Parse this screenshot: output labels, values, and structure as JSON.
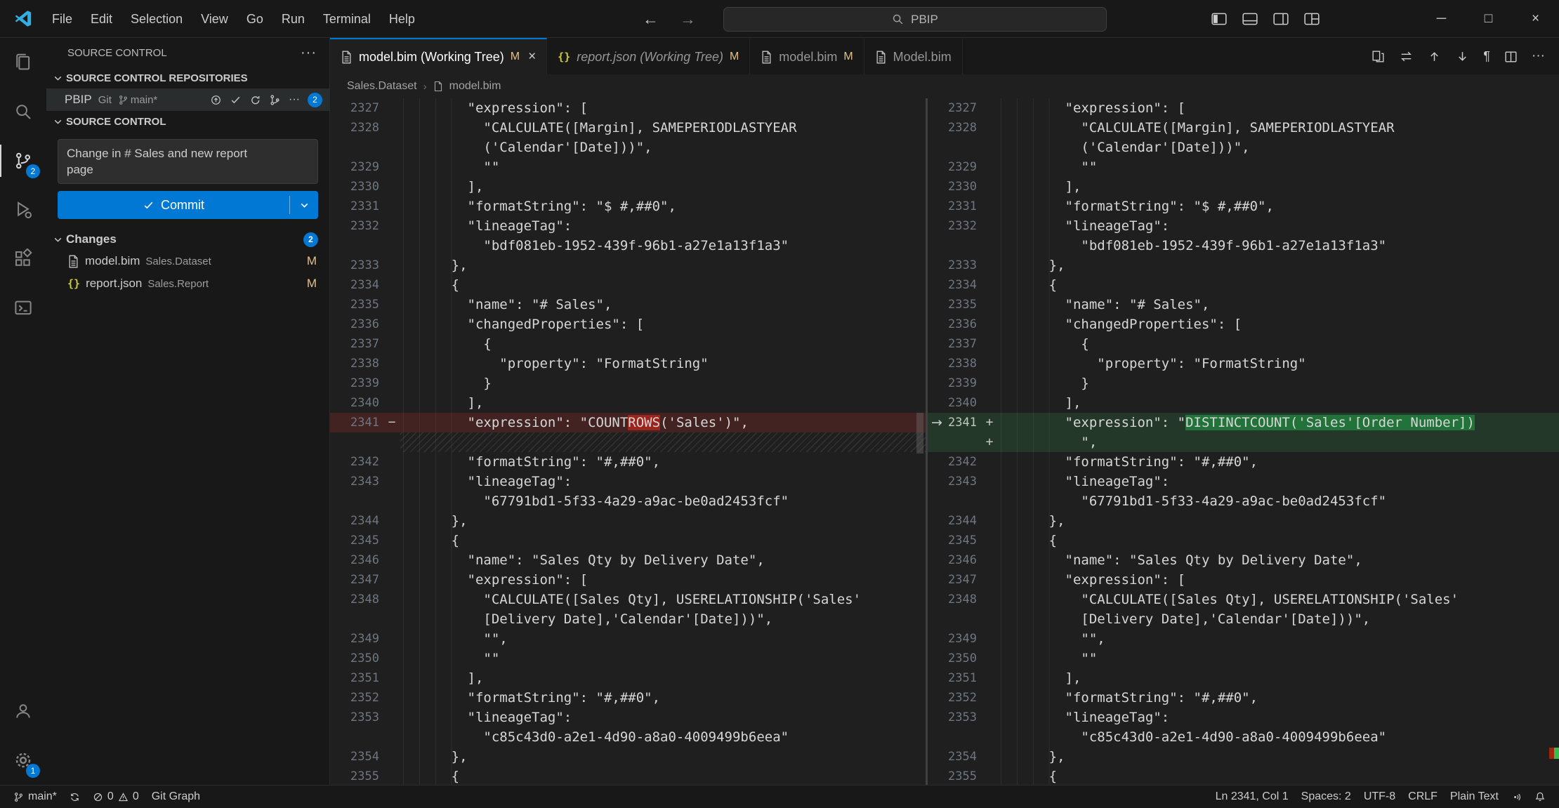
{
  "titlebar": {
    "menus": [
      "File",
      "Edit",
      "Selection",
      "View",
      "Go",
      "Run",
      "Terminal",
      "Help"
    ],
    "command_center": "PBIP"
  },
  "activity_bar": {
    "scm_badge": "2",
    "gear_badge": "1"
  },
  "sidebar": {
    "panel_title": "SOURCE CONTROL",
    "repos_section": "SOURCE CONTROL REPOSITORIES",
    "repo": {
      "name": "PBIP",
      "vcs": "Git",
      "branch": "main*",
      "badge": "2"
    },
    "scm_section": "SOURCE CONTROL",
    "commit_message": "Change in # Sales and new report\npage",
    "commit_label": "Commit",
    "changes_label": "Changes",
    "changes_badge": "2",
    "changes": [
      {
        "file": "model.bim",
        "project": "Sales.Dataset",
        "status": "M",
        "icon": "file"
      },
      {
        "file": "report.json",
        "project": "Sales.Report",
        "status": "M",
        "icon": "json"
      }
    ]
  },
  "tabs": [
    {
      "label": "model.bim (Working Tree)",
      "modified": "M",
      "active": true,
      "italic": false,
      "icon": "file"
    },
    {
      "label": "report.json (Working Tree)",
      "modified": "M",
      "active": false,
      "italic": true,
      "icon": "json"
    },
    {
      "label": "model.bim",
      "modified": "M",
      "active": false,
      "italic": false,
      "icon": "file"
    },
    {
      "label": "Model.bim",
      "modified": "",
      "active": false,
      "italic": false,
      "icon": "file"
    }
  ],
  "breadcrumb": [
    "Sales.Dataset",
    "model.bim"
  ],
  "editor": {
    "left_rows": [
      {
        "n": "2327",
        "t": "        \"expression\": ["
      },
      {
        "n": "2328",
        "t": "          \"CALCULATE([Margin], SAMEPERIODLASTYEAR"
      },
      {
        "n": "",
        "t": "          ('Calendar'[Date]))\","
      },
      {
        "n": "2329",
        "t": "          \"\""
      },
      {
        "n": "2330",
        "t": "        ],"
      },
      {
        "n": "2331",
        "t": "        \"formatString\": \"$ #,##0\","
      },
      {
        "n": "2332",
        "t": "        \"lineageTag\":"
      },
      {
        "n": "",
        "t": "          \"bdf081eb-1952-439f-96b1-a27e1a13f1a3\""
      },
      {
        "n": "2333",
        "t": "      },"
      },
      {
        "n": "2334",
        "t": "      {"
      },
      {
        "n": "2335",
        "t": "        \"name\": \"# Sales\","
      },
      {
        "n": "2336",
        "t": "        \"changedProperties\": ["
      },
      {
        "n": "2337",
        "t": "          {"
      },
      {
        "n": "2338",
        "t": "            \"property\": \"FormatString\""
      },
      {
        "n": "2339",
        "t": "          }"
      },
      {
        "n": "2340",
        "t": "        ],"
      },
      {
        "n": "2341",
        "mark": "−",
        "cls": "removed",
        "hl": [
          "        \"expression\": \"COUNT",
          "ROWS",
          "('Sales')\","
        ]
      },
      {
        "n": "",
        "cls": "hatch",
        "t": ""
      },
      {
        "n": "2342",
        "t": "        \"formatString\": \"#,##0\","
      },
      {
        "n": "2343",
        "t": "        \"lineageTag\":"
      },
      {
        "n": "",
        "t": "          \"67791bd1-5f33-4a29-a9ac-be0ad2453fcf\""
      },
      {
        "n": "2344",
        "t": "      },"
      },
      {
        "n": "2345",
        "t": "      {"
      },
      {
        "n": "2346",
        "t": "        \"name\": \"Sales Qty by Delivery Date\","
      },
      {
        "n": "2347",
        "t": "        \"expression\": ["
      },
      {
        "n": "2348",
        "t": "          \"CALCULATE([Sales Qty], USERELATIONSHIP('Sales'"
      },
      {
        "n": "",
        "t": "          [Delivery Date],'Calendar'[Date]))\","
      },
      {
        "n": "2349",
        "t": "          \"\","
      },
      {
        "n": "2350",
        "t": "          \"\""
      },
      {
        "n": "2351",
        "t": "        ],"
      },
      {
        "n": "2352",
        "t": "        \"formatString\": \"#,##0\","
      },
      {
        "n": "2353",
        "t": "        \"lineageTag\":"
      },
      {
        "n": "",
        "t": "          \"c85c43d0-a2e1-4d90-a8a0-4009499b6eea\""
      },
      {
        "n": "2354",
        "t": "      },"
      },
      {
        "n": "2355",
        "t": "      {"
      }
    ],
    "right_rows": [
      {
        "n": "2327",
        "t": "        \"expression\": ["
      },
      {
        "n": "2328",
        "t": "          \"CALCULATE([Margin], SAMEPERIODLASTYEAR"
      },
      {
        "n": "",
        "t": "          ('Calendar'[Date]))\","
      },
      {
        "n": "2329",
        "t": "          \"\""
      },
      {
        "n": "2330",
        "t": "        ],"
      },
      {
        "n": "2331",
        "t": "        \"formatString\": \"$ #,##0\","
      },
      {
        "n": "2332",
        "t": "        \"lineageTag\":"
      },
      {
        "n": "",
        "t": "          \"bdf081eb-1952-439f-96b1-a27e1a13f1a3\""
      },
      {
        "n": "2333",
        "t": "      },"
      },
      {
        "n": "2334",
        "t": "      {"
      },
      {
        "n": "2335",
        "t": "        \"name\": \"# Sales\","
      },
      {
        "n": "2336",
        "t": "        \"changedProperties\": ["
      },
      {
        "n": "2337",
        "t": "          {"
      },
      {
        "n": "2338",
        "t": "            \"property\": \"FormatString\""
      },
      {
        "n": "2339",
        "t": "          }"
      },
      {
        "n": "2340",
        "t": "        ],"
      },
      {
        "n": "2341",
        "mark": "+",
        "cls": "added",
        "arrow": true,
        "hl": [
          "        \"expression\": \"",
          "DISTINCTCOUNT('Sales'[Order Number])",
          ""
        ]
      },
      {
        "n": "",
        "mark": "+",
        "cls": "added",
        "t": "          \","
      },
      {
        "n": "2342",
        "t": "        \"formatString\": \"#,##0\","
      },
      {
        "n": "2343",
        "t": "        \"lineageTag\":"
      },
      {
        "n": "",
        "t": "          \"67791bd1-5f33-4a29-a9ac-be0ad2453fcf\""
      },
      {
        "n": "2344",
        "t": "      },"
      },
      {
        "n": "2345",
        "t": "      {"
      },
      {
        "n": "2346",
        "t": "        \"name\": \"Sales Qty by Delivery Date\","
      },
      {
        "n": "2347",
        "t": "        \"expression\": ["
      },
      {
        "n": "2348",
        "t": "          \"CALCULATE([Sales Qty], USERELATIONSHIP('Sales'"
      },
      {
        "n": "",
        "t": "          [Delivery Date],'Calendar'[Date]))\","
      },
      {
        "n": "2349",
        "t": "          \"\","
      },
      {
        "n": "2350",
        "t": "          \"\""
      },
      {
        "n": "2351",
        "t": "        ],"
      },
      {
        "n": "2352",
        "t": "        \"formatString\": \"#,##0\","
      },
      {
        "n": "2353",
        "t": "        \"lineageTag\":"
      },
      {
        "n": "",
        "t": "          \"c85c43d0-a2e1-4d90-a8a0-4009499b6eea\""
      },
      {
        "n": "2354",
        "t": "      },"
      },
      {
        "n": "2355",
        "t": "      {"
      }
    ]
  },
  "statusbar": {
    "branch": "main*",
    "errors": "0",
    "warnings": "0",
    "git_graph": "Git Graph",
    "line_col": "Ln 2341, Col 1",
    "indent": "Spaces: 2",
    "encoding": "UTF-8",
    "eol": "CRLF",
    "language": "Plain Text"
  }
}
